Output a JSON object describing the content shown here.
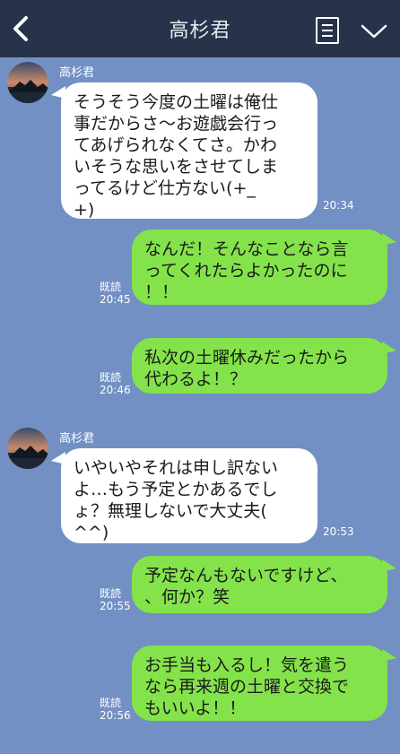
{
  "header": {
    "title": "高杉君",
    "back_icon": "chevron-left-icon",
    "menu_icon": "list-document-icon",
    "collapse_icon": "chevron-down-icon"
  },
  "colors": {
    "chat_background": "#7290c3",
    "header_background": "#27334a",
    "received_bubble": "#ffffff",
    "sent_bubble": "#84e34b"
  },
  "messages": [
    {
      "sender": "高杉君",
      "direction": "received",
      "lines": [
        "そうそう今度の土曜は俺仕",
        "事だからさ〜お遊戯会行っ",
        "てあげられなくてさ。かわ",
        "いそうな思いをさせてしま",
        "ってるけど仕方ない(+_",
        "+)"
      ],
      "time": "20:34"
    },
    {
      "direction": "sent",
      "lines": [
        "なんだ！そんなことなら言",
        "ってくれたらよかったのに",
        "！！"
      ],
      "read": "既読",
      "time": "20:45"
    },
    {
      "direction": "sent",
      "lines": [
        "私次の土曜休みだったから",
        "代わるよ！？"
      ],
      "read": "既読",
      "time": "20:46"
    },
    {
      "sender": "高杉君",
      "direction": "received",
      "lines": [
        "いやいやそれは申し訳ない",
        "よ…もう予定とかあるでし",
        "ょ？無理しないで大丈夫(",
        "^^)"
      ],
      "time": "20:53"
    },
    {
      "direction": "sent",
      "lines": [
        "予定なんもないですけど、",
        "、何か？笑"
      ],
      "read": "既読",
      "time": "20:55"
    },
    {
      "direction": "sent",
      "lines": [
        "お手当も入るし！気を遣う",
        "なら再来週の土曜と交換で",
        "もいいよ！！"
      ],
      "read": "既読",
      "time": "20:56"
    }
  ]
}
